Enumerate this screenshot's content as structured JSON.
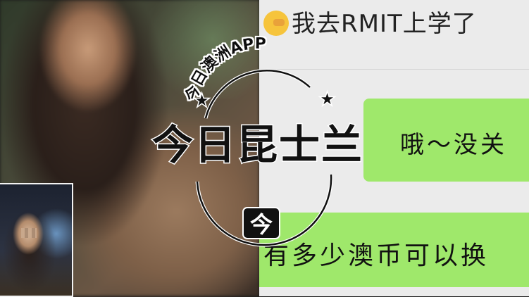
{
  "watermark": {
    "arc_text": "今日澳洲APP",
    "brand_text": "今日昆士兰",
    "badge_char": "今"
  },
  "chat": {
    "title": "我去RMIT上学了",
    "title_icon": "facepalm-emoji-icon",
    "bubble_1": "哦～没关",
    "bubble_2": "有多少澳币可以换"
  },
  "colors": {
    "chat_background": "#ebebeb",
    "bubble_green": "#9fe86b",
    "watermark": "#111111"
  }
}
